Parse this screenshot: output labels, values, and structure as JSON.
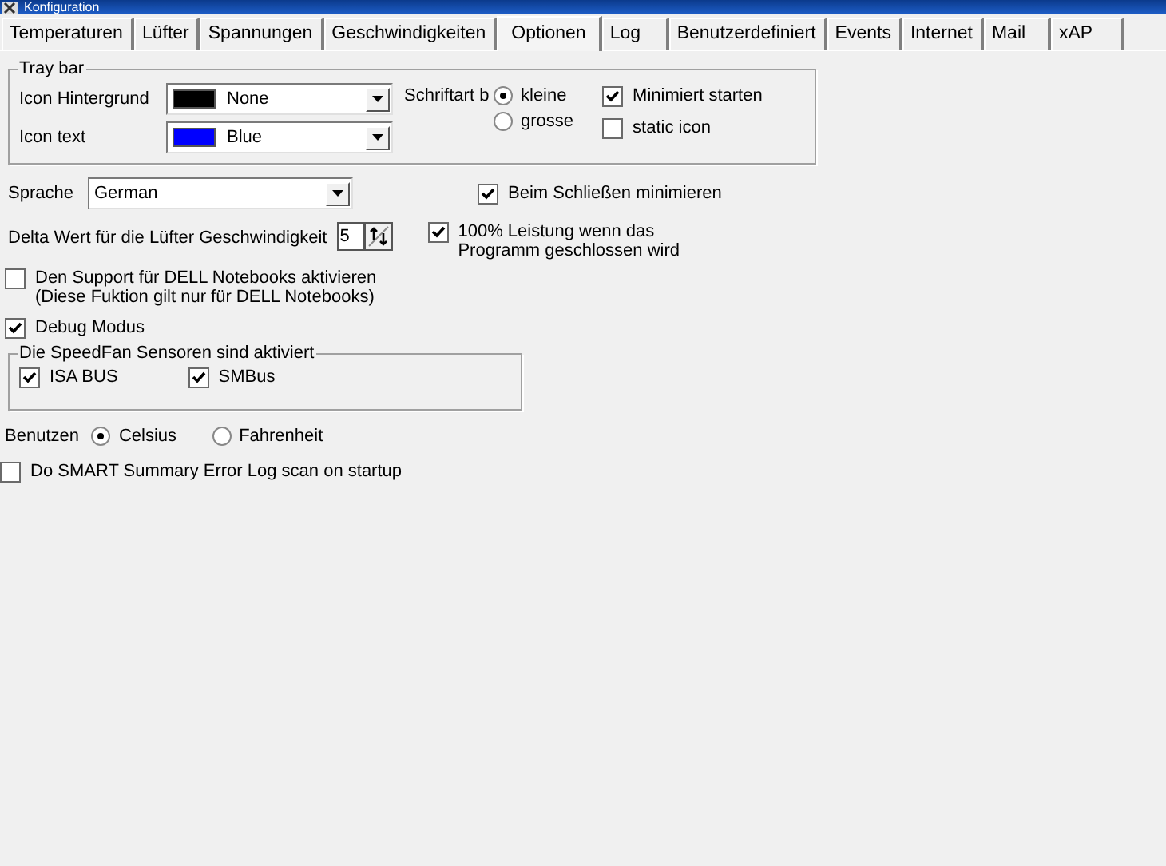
{
  "window": {
    "title": "Konfiguration"
  },
  "tabs": [
    {
      "label": "Temperaturen",
      "selected": false
    },
    {
      "label": "Lüfter",
      "selected": false
    },
    {
      "label": "Spannungen",
      "selected": false
    },
    {
      "label": "Geschwindigkeiten",
      "selected": false
    },
    {
      "label": "Optionen",
      "selected": true
    },
    {
      "label": "Log",
      "selected": false
    },
    {
      "label": "Benutzerdefiniert",
      "selected": false
    },
    {
      "label": "Events",
      "selected": false
    },
    {
      "label": "Internet",
      "selected": false
    },
    {
      "label": "Mail",
      "selected": false
    },
    {
      "label": "xAP",
      "selected": false
    }
  ],
  "tray_bar": {
    "title": "Tray bar",
    "dropdowns": [
      {
        "label": "Icon Hintergrund",
        "value": "None",
        "color": "#000000"
      },
      {
        "label": "Icon text",
        "value": "Blue",
        "color": "#0000ff"
      }
    ],
    "font_size": {
      "label": "Schriftart b",
      "options": [
        {
          "label": "kleine",
          "selected": true
        },
        {
          "label": "grosse",
          "selected": false
        }
      ]
    },
    "checkboxes": [
      {
        "label": "Minimiert starten",
        "checked": true
      },
      {
        "label": "static icon",
        "checked": false
      }
    ]
  },
  "language": {
    "label": "Sprache",
    "value": "German"
  },
  "minimize_on_close": {
    "label": "Beim Schließen minimieren",
    "checked": true
  },
  "fan_delta": {
    "label": "Delta Wert für die Lüfter Geschwindigkeit",
    "value": "5"
  },
  "full_power_on_exit": {
    "label": "100% Leistung wenn das Programm geschlossen wird",
    "checked": true
  },
  "dell_support": {
    "label": "Den Support für DELL Notebooks aktivieren",
    "note": "(Diese Fuktion gilt nur für DELL Notebooks)",
    "checked": false
  },
  "debug_mode": {
    "label": "Debug Modus",
    "checked": true
  },
  "sensors": {
    "title": "Die SpeedFan Sensoren sind aktiviert",
    "items": [
      {
        "label": "ISA BUS",
        "checked": true
      },
      {
        "label": "SMBus",
        "checked": true
      }
    ]
  },
  "units": {
    "label": "Benutzen",
    "options": [
      {
        "label": "Celsius",
        "selected": true
      },
      {
        "label": "Fahrenheit",
        "selected": false
      }
    ]
  },
  "smart_scan": {
    "label": "Do SMART Summary Error Log scan on startup",
    "checked": false
  }
}
